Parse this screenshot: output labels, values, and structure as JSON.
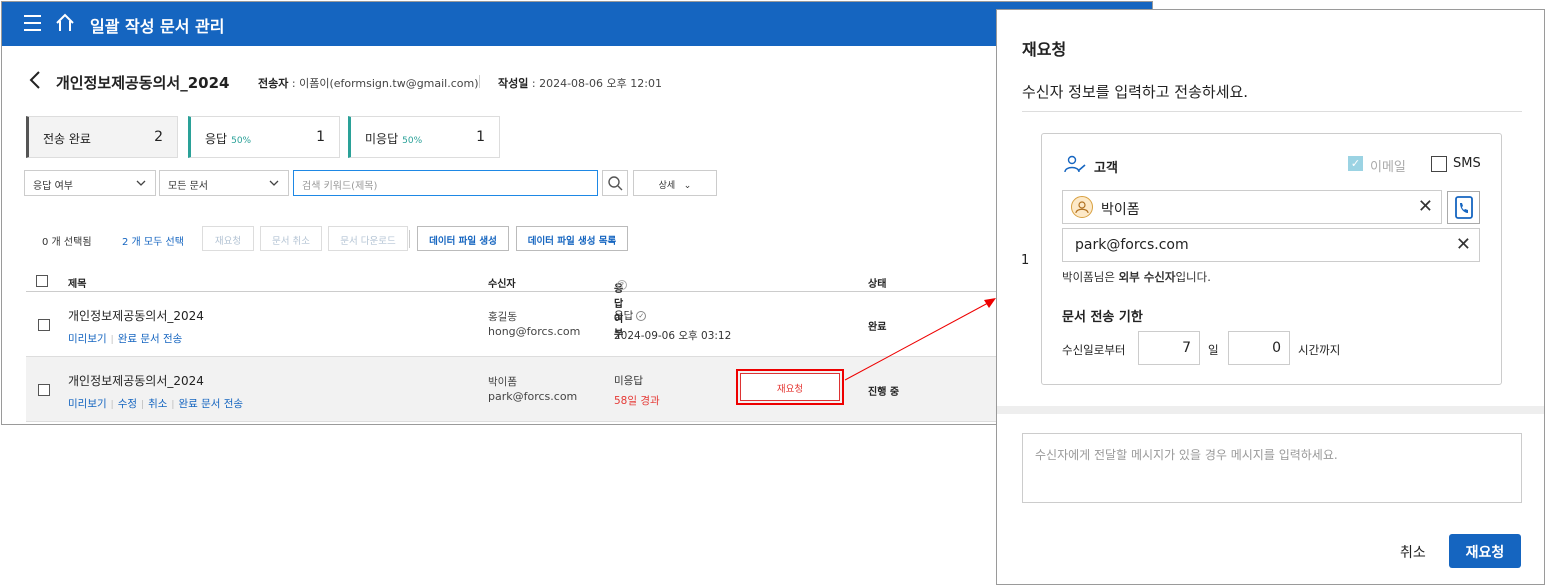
{
  "header": {
    "title": "일괄 작성 문서 관리",
    "icons": [
      "menu-icon",
      "home-icon"
    ]
  },
  "document": {
    "title": "개인정보제공동의서_2024",
    "sender_label": "전송자",
    "sender_value": "이폼이(eformsign.tw@gmail.com)",
    "date_label": "작성일",
    "date_value": "2024-08-06 오후 12:01"
  },
  "stats": [
    {
      "label": "전송 완료",
      "pct": "",
      "value": "2"
    },
    {
      "label": "응답",
      "pct": "50%",
      "value": "1"
    },
    {
      "label": "미응답",
      "pct": "50%",
      "value": "1"
    }
  ],
  "filters": {
    "response_select": "응답 여부",
    "docs_select": "모든 문서",
    "search_placeholder": "검색 키워드(제목)",
    "detail": "상세"
  },
  "toolbar": {
    "selected_count": "0 개 선택됨",
    "select_all": "2 개 모두 선택",
    "buttons": [
      "재요청",
      "문서 취소",
      "문서 다운로드",
      "데이터 파일 생성",
      "데이터 파일 생성 목록"
    ]
  },
  "table": {
    "columns": [
      "제목",
      "수신자",
      "응답 여부",
      "상태"
    ],
    "rows": [
      {
        "title": "개인정보제공동의서_2024",
        "links": [
          "미리보기",
          "완료 문서 전송"
        ],
        "recipient_name": "홍길동",
        "recipient_email": "hong@forcs.com",
        "response": "응답",
        "response_detail": "2024-09-06 오후 03:12",
        "status": "완료"
      },
      {
        "title": "개인정보제공동의서_2024",
        "links": [
          "미리보기",
          "수정",
          "취소",
          "완료 문서 전송"
        ],
        "recipient_name": "박이폼",
        "recipient_email": "park@forcs.com",
        "response": "미응답",
        "response_detail": "58일 경과",
        "action": "재요청",
        "status": "진행 중"
      }
    ]
  },
  "modal": {
    "title": "재요청",
    "subtitle": "수신자 정보를 입력하고 전송하세요.",
    "index": "1",
    "role": "고객",
    "email_option": "이메일",
    "sms_option": "SMS",
    "name": "박이폼",
    "email": "park@forcs.com",
    "external_note_prefix": "박이폼님은 ",
    "external_note_bold": "외부 수신자",
    "external_note_suffix": "입니다.",
    "deadline_title": "문서 전송 기한",
    "deadline_from": "수신일로부터",
    "days": "7",
    "days_unit": "일",
    "hours": "0",
    "hours_unit": "시간까지",
    "message_placeholder": "수신자에게 전달할 메시지가 있을 경우 메시지를 입력하세요.",
    "cancel": "취소",
    "submit": "재요청"
  },
  "colors": {
    "primary": "#1565c0",
    "accent": "#2aa198",
    "danger": "#e53935"
  }
}
